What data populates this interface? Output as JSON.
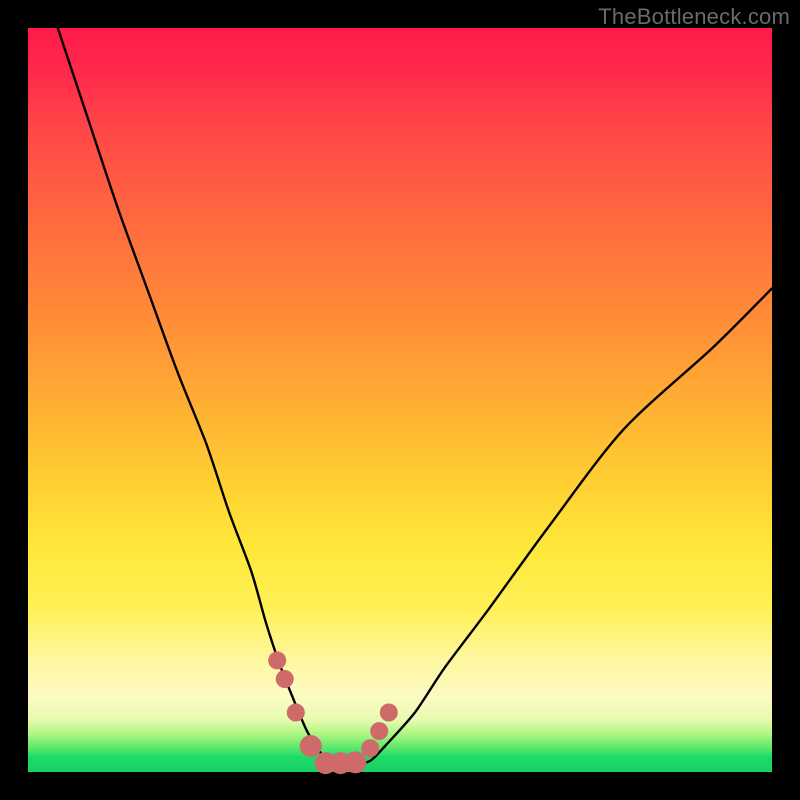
{
  "watermark": "TheBottleneck.com",
  "colors": {
    "frame": "#000000",
    "curve": "#000000",
    "dots": "#cf6a6a",
    "gradient_top": "#ff1a4a",
    "gradient_bottom": "#18d166"
  },
  "chart_data": {
    "type": "line",
    "title": "",
    "xlabel": "",
    "ylabel": "",
    "xlim": [
      0,
      100
    ],
    "ylim": [
      0,
      100
    ],
    "series": [
      {
        "name": "bottleneck-curve",
        "x": [
          4,
          8,
          12,
          16,
          20,
          24,
          27,
          30,
          32,
          34,
          36,
          37.5,
          39,
          40.5,
          42,
          44,
          46,
          48,
          52,
          56,
          62,
          70,
          80,
          92,
          100
        ],
        "y": [
          100,
          88,
          76,
          65,
          54,
          44,
          35,
          27,
          20,
          14,
          9,
          5.5,
          3,
          1.5,
          1,
          1,
          1.5,
          3.5,
          8,
          14,
          22,
          33,
          46,
          57,
          65
        ]
      }
    ],
    "markers": {
      "name": "highlight-dots",
      "x": [
        33.5,
        34.5,
        36,
        38,
        40,
        42,
        44,
        46,
        47.2,
        48.5
      ],
      "y": [
        15,
        12.5,
        8,
        3.5,
        1.2,
        1.2,
        1.3,
        3.2,
        5.5,
        8
      ]
    },
    "annotations": []
  }
}
